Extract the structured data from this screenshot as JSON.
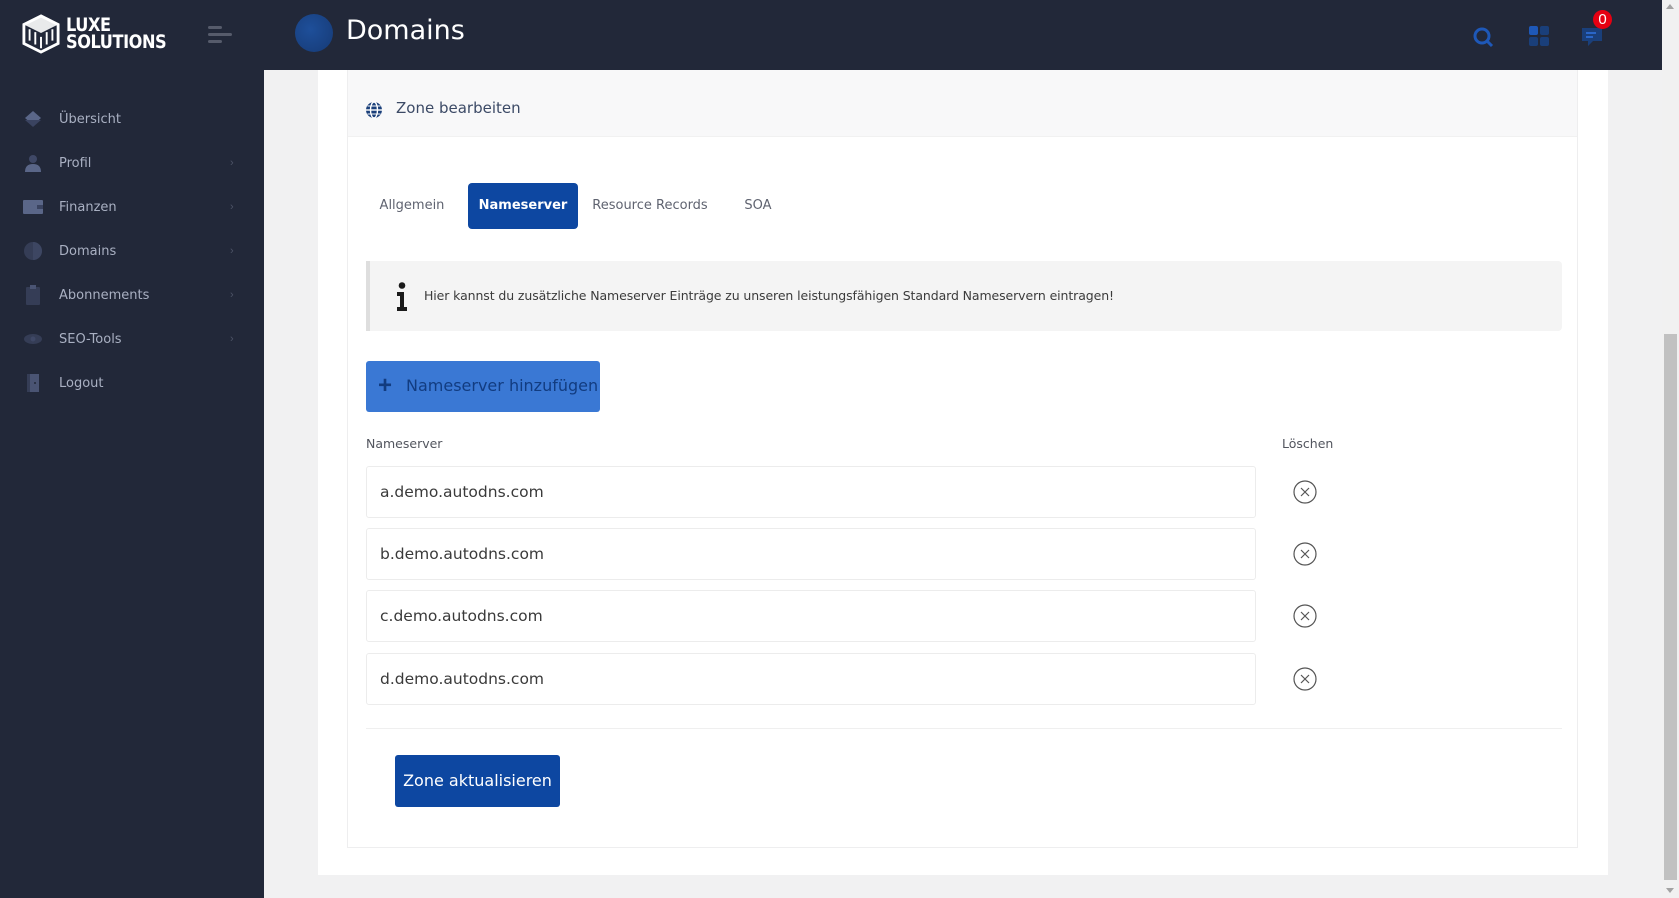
{
  "brand": {
    "line1": "LUXE",
    "line2": "SOLUTIONS"
  },
  "header": {
    "title": "Domains",
    "notification_count": "0",
    "icons": [
      "search-icon",
      "apps-grid-icon",
      "chat-icon"
    ]
  },
  "sidebar": {
    "items": [
      {
        "label": "Übersicht",
        "icon": "dashboard-icon",
        "has_submenu": false
      },
      {
        "label": "Profil",
        "icon": "user-icon",
        "has_submenu": true
      },
      {
        "label": "Finanzen",
        "icon": "wallet-icon",
        "has_submenu": true
      },
      {
        "label": "Domains",
        "icon": "globe-icon",
        "has_submenu": true
      },
      {
        "label": "Abonnements",
        "icon": "clipboard-icon",
        "has_submenu": true
      },
      {
        "label": "SEO-Tools",
        "icon": "eye-icon",
        "has_submenu": true
      },
      {
        "label": "Logout",
        "icon": "door-icon",
        "has_submenu": false
      }
    ],
    "chevron": "›"
  },
  "zone": {
    "title": "Zone bearbeiten",
    "tabs": [
      {
        "label": "Allgemein",
        "active": false
      },
      {
        "label": "Nameserver",
        "active": true
      },
      {
        "label": "Resource Records",
        "active": false
      },
      {
        "label": "SOA",
        "active": false
      }
    ],
    "info_text": "Hier kannst du zusätzliche Nameserver Einträge zu unseren leistungsfähigen Standard Nameservern eintragen!",
    "add_button": "Nameserver hinzufügen",
    "columns": {
      "nameserver": "Nameserver",
      "delete": "Löschen"
    },
    "nameservers": [
      "a.demo.autodns.com",
      "b.demo.autodns.com",
      "c.demo.autodns.com",
      "d.demo.autodns.com"
    ],
    "submit_button": "Zone aktualisieren"
  },
  "colors": {
    "navy": "#222839",
    "primary": "#0d47a1",
    "add_button": "#3a78d4",
    "badge": "#e60012"
  }
}
